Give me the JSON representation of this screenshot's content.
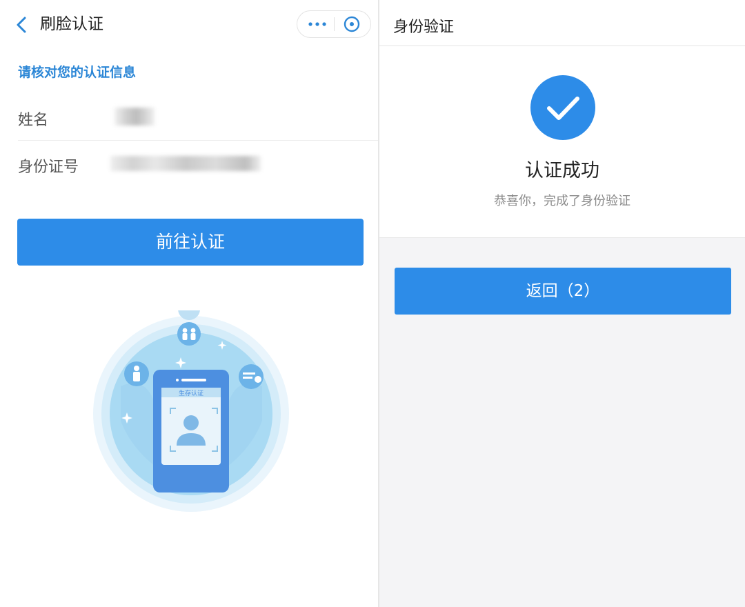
{
  "left": {
    "nav_title": "刷脸认证",
    "hint": "请核对您的认证信息",
    "rows": [
      {
        "label": "姓名"
      },
      {
        "label": "身份证号"
      }
    ],
    "primary_button": "前往认证",
    "illustration": {
      "card_label": "生存认证"
    }
  },
  "right": {
    "nav_title": "身份验证",
    "success_title": "认证成功",
    "success_subtitle": "恭喜你，完成了身份验证",
    "return_button": "返回（2）"
  },
  "colors": {
    "accent": "#2d8ce8",
    "hint_text": "#2b86d6",
    "page_background_right": "#f4f4f6"
  },
  "icons": {
    "back": "chevron-left-icon",
    "more": "more-dots-icon",
    "close": "close-circle-icon",
    "success": "check-circle-icon"
  }
}
